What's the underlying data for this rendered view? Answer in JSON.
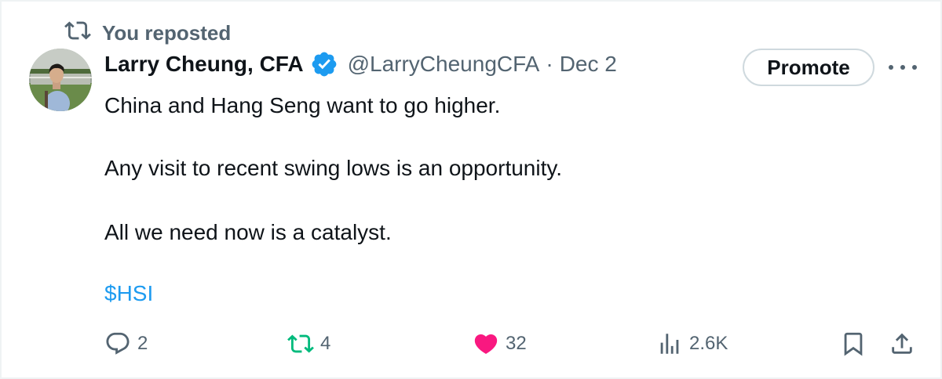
{
  "repost": {
    "label": "You reposted",
    "icon": "repost-icon"
  },
  "author": {
    "name": "Larry Cheung, CFA",
    "handle": "@LarryCheungCFA",
    "separator": "·",
    "date": "Dec 2",
    "verified_icon": "verified-badge-icon",
    "verified_color": "#1d9bf0"
  },
  "promote_label": "Promote",
  "more_icon": "more-icon",
  "content": {
    "line1": "China and Hang Seng want to go higher.",
    "line2": "Any visit to recent swing lows is an opportunity.",
    "line3": "All we need now is a catalyst.",
    "cashtag": "$HSI"
  },
  "actions": {
    "replies": "2",
    "reposts": "4",
    "likes": "32",
    "views": "2.6K"
  },
  "colors": {
    "text": "#0f1419",
    "secondary": "#536471",
    "link": "#1d9bf0",
    "repost_active": "#00ba7c",
    "like_active": "#f91880"
  }
}
